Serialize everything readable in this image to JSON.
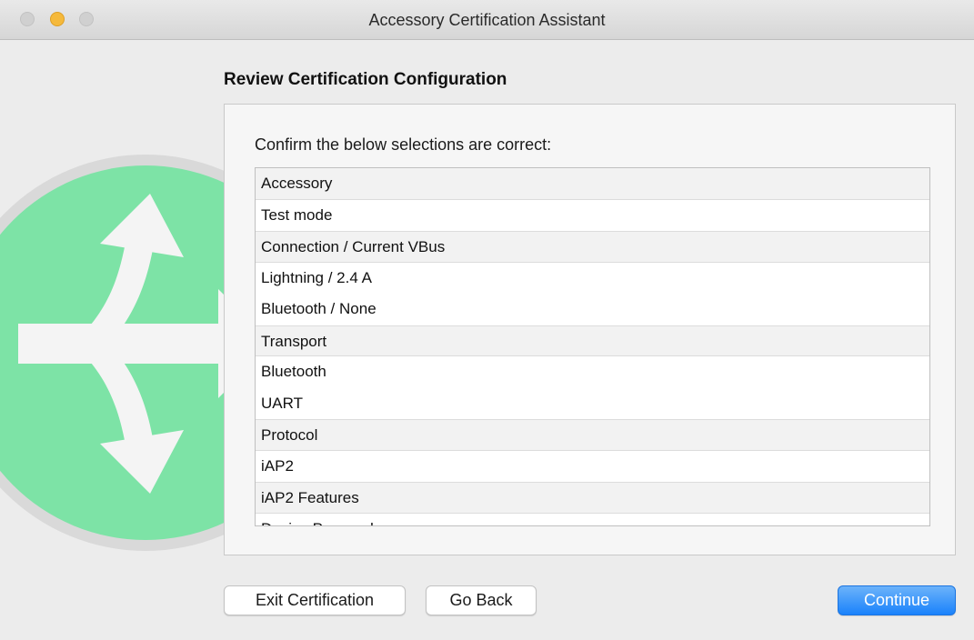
{
  "window": {
    "title": "Accessory Certification Assistant"
  },
  "background_icon": {
    "name": "branching-arrows-icon",
    "circle_color": "#7de3a6",
    "rim_color": "#d9d9d9",
    "arrow_color": "#f4f4f4"
  },
  "main": {
    "heading": "Review Certification Configuration",
    "instruction": "Confirm the below selections are correct:",
    "list": [
      {
        "type": "header",
        "text": "Accessory"
      },
      {
        "type": "item",
        "text": "Test mode"
      },
      {
        "type": "header",
        "text": "Connection / Current VBus"
      },
      {
        "type": "item",
        "text": "Lightning / 2.4 A"
      },
      {
        "type": "item",
        "text": "Bluetooth / None"
      },
      {
        "type": "header",
        "text": "Transport"
      },
      {
        "type": "item",
        "text": "Bluetooth"
      },
      {
        "type": "item",
        "text": "UART"
      },
      {
        "type": "header",
        "text": "Protocol"
      },
      {
        "type": "item",
        "text": "iAP2"
      },
      {
        "type": "header",
        "text": "iAP2 Features"
      },
      {
        "type": "item",
        "text": "Device Powered"
      }
    ]
  },
  "buttons": {
    "exit_label": "Exit Certification",
    "back_label": "Go Back",
    "continue_label": "Continue"
  },
  "colors": {
    "accent": "#1a82fb"
  }
}
